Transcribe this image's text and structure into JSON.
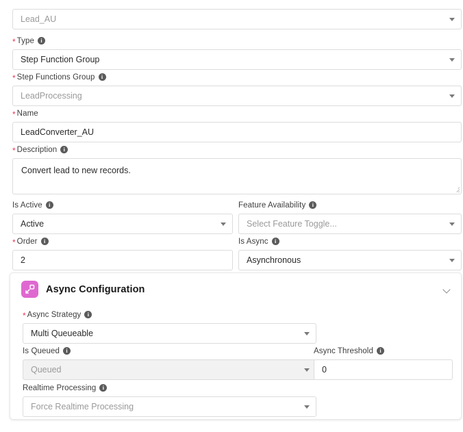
{
  "form": {
    "fields": [
      {
        "key": "object",
        "label": "",
        "required": false,
        "has_info": false,
        "control": "select",
        "value": "Lead_AU",
        "muted": true,
        "disabled": false
      },
      {
        "key": "type",
        "label": "Type",
        "required": true,
        "has_info": true,
        "control": "select",
        "value": "Step Function Group",
        "muted": false,
        "disabled": false
      },
      {
        "key": "step_functions_group",
        "label": "Step Functions Group",
        "required": true,
        "has_info": true,
        "control": "select",
        "value": "LeadProcessing",
        "muted": true,
        "disabled": false
      },
      {
        "key": "name",
        "label": "Name",
        "required": true,
        "has_info": false,
        "control": "text",
        "value": "LeadConverter_AU",
        "muted": false,
        "disabled": false
      },
      {
        "key": "description",
        "label": "Description",
        "required": true,
        "has_info": true,
        "control": "textarea",
        "value": "Convert lead to new records.",
        "muted": false,
        "disabled": false
      },
      {
        "key": "is_active",
        "label": "Is Active",
        "required": false,
        "has_info": true,
        "control": "select",
        "value": "Active",
        "muted": false,
        "disabled": false
      },
      {
        "key": "feature_availability",
        "label": "Feature Availability",
        "required": false,
        "has_info": true,
        "control": "select",
        "value": "Select Feature Toggle...",
        "muted": true,
        "disabled": false
      },
      {
        "key": "order",
        "label": "Order",
        "required": true,
        "has_info": true,
        "control": "text",
        "value": "2",
        "muted": false,
        "disabled": false
      },
      {
        "key": "is_async",
        "label": "Is Async",
        "required": false,
        "has_info": true,
        "control": "select",
        "value": "Asynchronous",
        "muted": false,
        "disabled": false
      }
    ]
  },
  "async_card": {
    "title": "Async Configuration",
    "icon": "expand-arrow-icon",
    "icon_color": "#df68d0",
    "collapse_icon": "chevron-down-icon",
    "fields": [
      {
        "key": "async_strategy",
        "label": "Async Strategy",
        "required": true,
        "has_info": true,
        "control": "select",
        "value": "Multi Queueable",
        "muted": false,
        "disabled": false
      },
      {
        "key": "is_queued",
        "label": "Is Queued",
        "required": false,
        "has_info": true,
        "control": "select",
        "value": "Queued",
        "muted": true,
        "disabled": true
      },
      {
        "key": "async_threshold",
        "label": "Async Threshold",
        "required": false,
        "has_info": true,
        "control": "text",
        "value": "0",
        "muted": false,
        "disabled": false
      },
      {
        "key": "realtime_processing",
        "label": "Realtime Processing",
        "required": false,
        "has_info": true,
        "control": "select",
        "value": "Force Realtime Processing",
        "muted": true,
        "disabled": false
      }
    ]
  }
}
